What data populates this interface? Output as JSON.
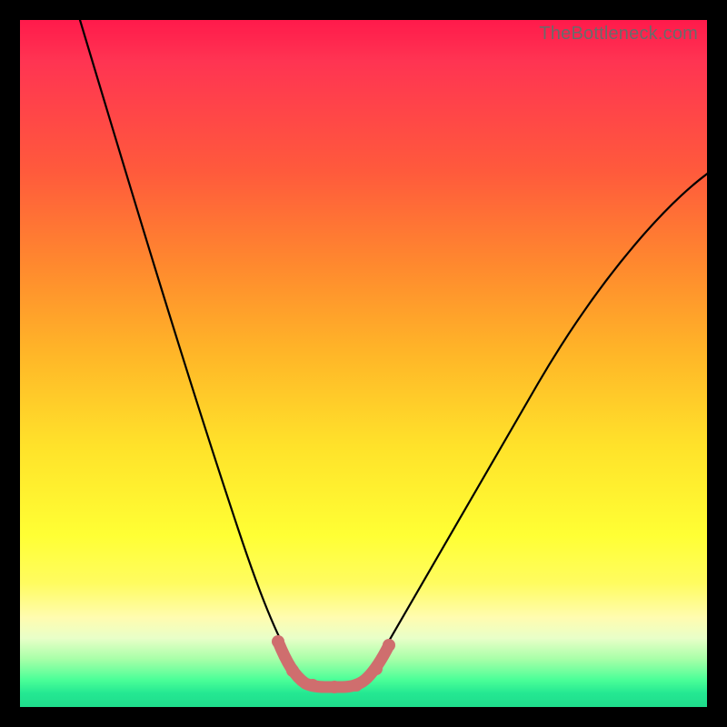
{
  "watermark": "TheBottleneck.com",
  "colors": {
    "background": "#000000",
    "curve_main": "#000000",
    "curve_accent": "#d16a6a"
  },
  "chart_data": {
    "type": "line",
    "title": "",
    "xlabel": "",
    "ylabel": "",
    "xlim": [
      0,
      100
    ],
    "ylim": [
      0,
      100
    ],
    "series": [
      {
        "name": "bottleneck-curve",
        "x": [
          0,
          5,
          10,
          15,
          20,
          25,
          28,
          30,
          32,
          34,
          36,
          38,
          40,
          42,
          45,
          50,
          55,
          60,
          65,
          70,
          75,
          80,
          85,
          90,
          95,
          100
        ],
        "values": [
          102,
          90,
          78,
          66,
          54,
          40,
          30,
          22,
          15,
          9,
          5,
          3,
          2,
          2,
          3,
          6,
          10,
          15,
          21,
          28,
          35,
          42,
          49,
          56,
          62,
          68
        ]
      }
    ],
    "accent_region_x": [
      33,
      47
    ],
    "annotations": []
  }
}
